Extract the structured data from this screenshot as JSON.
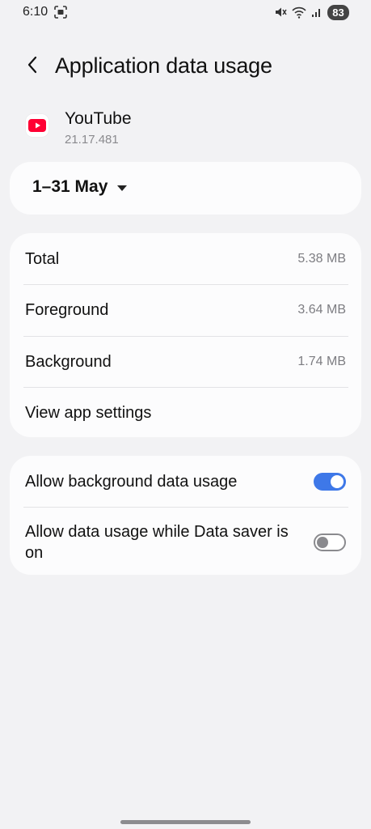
{
  "status_bar": {
    "time": "6:10",
    "battery": "83",
    "icons": [
      "screenshot-icon",
      "mute-icon",
      "wifi-icon",
      "signal-icon"
    ]
  },
  "header": {
    "title": "Application data usage",
    "back_icon": "back-arrow-icon"
  },
  "app": {
    "name": "YouTube",
    "version": "21.17.481",
    "icon": "youtube-icon",
    "brand_color": "#ff0033"
  },
  "date_range": {
    "label": "1–31 May",
    "icon": "dropdown-arrow-icon"
  },
  "usage": {
    "total_label": "Total",
    "total_value": "5.38 MB",
    "foreground_label": "Foreground",
    "foreground_value": "3.64 MB",
    "background_label": "Background",
    "background_value": "1.74 MB",
    "settings_link": "View app settings"
  },
  "settings": {
    "background_data": {
      "label": "Allow background data usage",
      "enabled": true
    },
    "data_saver": {
      "label": "Allow data usage while Data saver is on",
      "enabled": false
    },
    "accent_color": "#3e78e8"
  }
}
